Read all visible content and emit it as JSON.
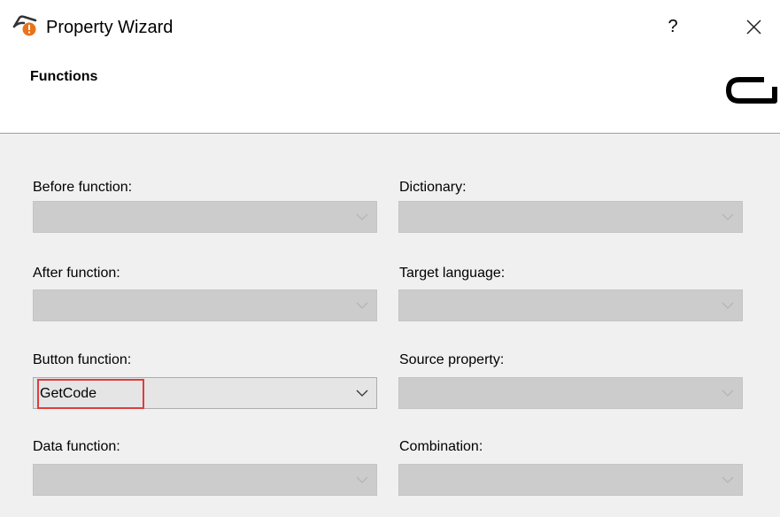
{
  "window": {
    "title": "Property Wizard",
    "help_label": "?",
    "icons": {
      "app": "app-icon",
      "close": "close-icon"
    }
  },
  "header": {
    "title": "Functions",
    "logo": "logo-mark"
  },
  "fields": {
    "before_function": {
      "label": "Before function:",
      "value": ""
    },
    "after_function": {
      "label": "After function:",
      "value": ""
    },
    "button_function": {
      "label": "Button function:",
      "value": "GetCode"
    },
    "data_function": {
      "label": "Data function:",
      "value": ""
    },
    "dictionary": {
      "label": "Dictionary:",
      "value": ""
    },
    "target_language": {
      "label": "Target language:",
      "value": ""
    },
    "source_property": {
      "label": "Source property:",
      "value": ""
    },
    "combination": {
      "label": "Combination:",
      "value": ""
    }
  },
  "colors": {
    "highlight": "#e03c3c",
    "disabled_combo": "#cccccc",
    "enabled_combo": "#e5e5e5",
    "icon_orange": "#e8731a"
  }
}
